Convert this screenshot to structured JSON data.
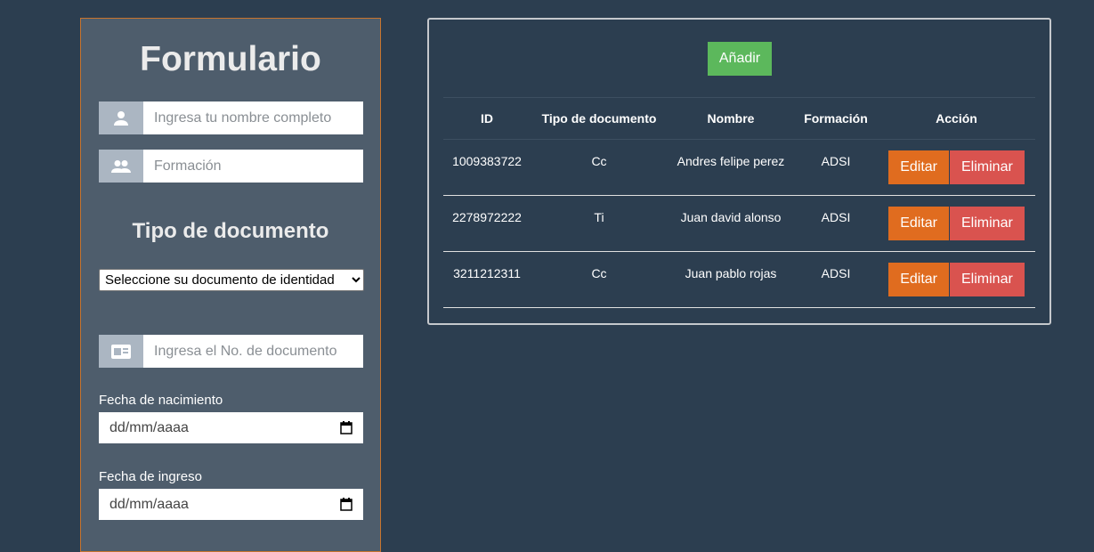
{
  "form": {
    "title": "Formulario",
    "name_placeholder": "Ingresa tu nombre completo",
    "formation_placeholder": "Formación",
    "doc_type_title": "Tipo de documento",
    "doc_type_selected": "Seleccione su documento de identidad",
    "doc_number_placeholder": "Ingresa el No. de documento",
    "birth_label": "Fecha de nacimiento",
    "birth_value": "dd/mm/aaaa",
    "entry_label": "Fecha de ingreso",
    "entry_value": "dd/mm/aaaa"
  },
  "table": {
    "add_label": "Añadir",
    "headers": [
      "ID",
      "Tipo de documento",
      "Nombre",
      "Formación",
      "Acción"
    ],
    "rows": [
      {
        "id": "1009383722",
        "doc_type": "Cc",
        "name": "Andres felipe perez",
        "formation": "ADSI",
        "edit": "Editar",
        "delete": "Eliminar"
      },
      {
        "id": "2278972222",
        "doc_type": "Ti",
        "name": "Juan david alonso",
        "formation": "ADSI",
        "edit": "Editar",
        "delete": "Eliminar"
      },
      {
        "id": "3211212311",
        "doc_type": "Cc",
        "name": "Juan pablo rojas",
        "formation": "ADSI",
        "edit": "Editar",
        "delete": "Eliminar"
      }
    ]
  },
  "icons": {
    "name_field": "user-icon",
    "formation_field": "users-icon",
    "doc_number_field": "id-card-icon",
    "date_picker": "calendar-icon"
  },
  "colors": {
    "background": "#2c3e50",
    "panel": "#4e5d6c",
    "panel_border": "#c8742e",
    "add_button": "#5cb85c",
    "edit_button": "#e06c1f",
    "delete_button": "#d9534f"
  }
}
